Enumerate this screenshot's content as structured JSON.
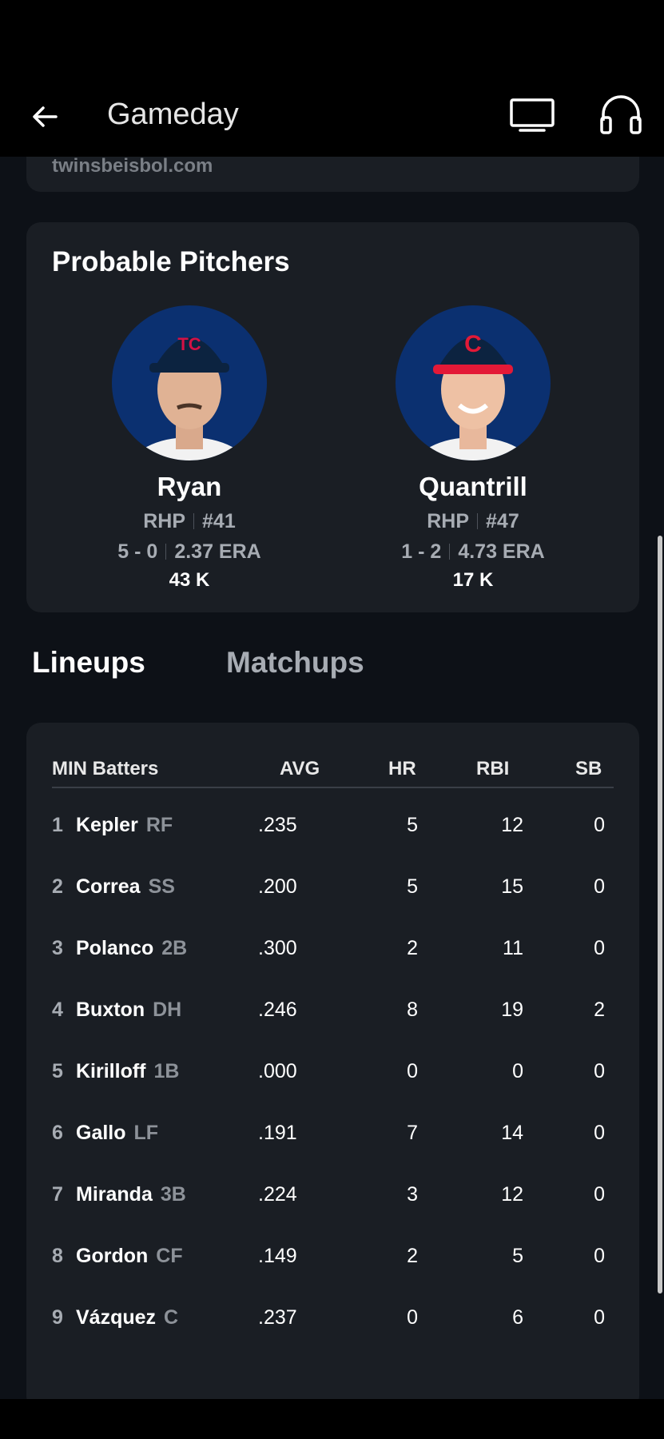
{
  "app_bar": {
    "title": "Gameday"
  },
  "link_card": {
    "text": "twinsbeisbol.com"
  },
  "probable_pitchers": {
    "title": "Probable Pitchers",
    "pitchers": [
      {
        "name": "Ryan",
        "throws": "RHP",
        "number": "#41",
        "record": "5 - 0",
        "era": "2.37 ERA",
        "strikeouts": "43 K",
        "cap_color": "#0c2340",
        "cap_letter": "TC"
      },
      {
        "name": "Quantrill",
        "throws": "RHP",
        "number": "#47",
        "record": "1 - 2",
        "era": "4.73 ERA",
        "strikeouts": "17 K",
        "cap_color": "#0c2340",
        "cap_letter": "C"
      }
    ]
  },
  "tabs": {
    "lineups": "Lineups",
    "matchups": "Matchups"
  },
  "lineup": {
    "headers": {
      "batters": "MIN Batters",
      "avg": "AVG",
      "hr": "HR",
      "rbi": "RBI",
      "sb": "SB"
    },
    "rows": [
      {
        "num": "1",
        "name": "Kepler",
        "pos": "RF",
        "avg": ".235",
        "hr": "5",
        "rbi": "12",
        "sb": "0"
      },
      {
        "num": "2",
        "name": "Correa",
        "pos": "SS",
        "avg": ".200",
        "hr": "5",
        "rbi": "15",
        "sb": "0"
      },
      {
        "num": "3",
        "name": "Polanco",
        "pos": "2B",
        "avg": ".300",
        "hr": "2",
        "rbi": "11",
        "sb": "0"
      },
      {
        "num": "4",
        "name": "Buxton",
        "pos": "DH",
        "avg": ".246",
        "hr": "8",
        "rbi": "19",
        "sb": "2"
      },
      {
        "num": "5",
        "name": "Kirilloff",
        "pos": "1B",
        "avg": ".000",
        "hr": "0",
        "rbi": "0",
        "sb": "0"
      },
      {
        "num": "6",
        "name": "Gallo",
        "pos": "LF",
        "avg": ".191",
        "hr": "7",
        "rbi": "14",
        "sb": "0"
      },
      {
        "num": "7",
        "name": "Miranda",
        "pos": "3B",
        "avg": ".224",
        "hr": "3",
        "rbi": "12",
        "sb": "0"
      },
      {
        "num": "8",
        "name": "Gordon",
        "pos": "CF",
        "avg": ".149",
        "hr": "2",
        "rbi": "5",
        "sb": "0"
      },
      {
        "num": "9",
        "name": "Vázquez",
        "pos": "C",
        "avg": ".237",
        "hr": "0",
        "rbi": "6",
        "sb": "0"
      }
    ]
  },
  "colors": {
    "background": "#0d1117",
    "card": "#1a1e24",
    "avatar_bg": "#0b3070"
  },
  "icons": {
    "back": "arrow-left-icon",
    "tv": "tv-icon",
    "audio": "headphones-icon"
  }
}
